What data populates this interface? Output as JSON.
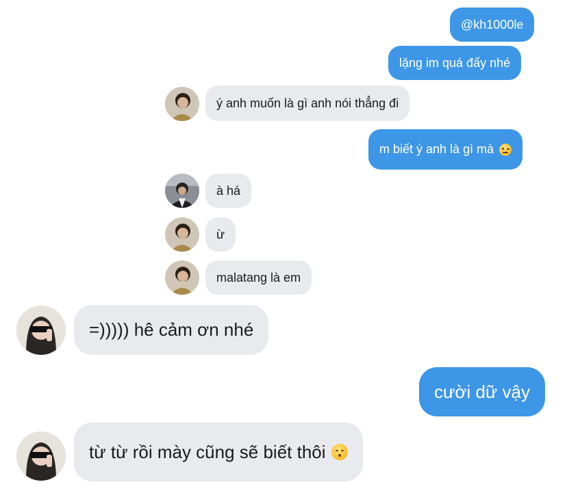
{
  "messages": [
    {
      "id": "m1",
      "side": "out",
      "text": "@kh1000le"
    },
    {
      "id": "m2",
      "side": "out",
      "text": "lặng im quá đấy nhé"
    },
    {
      "id": "m3",
      "side": "in",
      "avatar": "male-avatar",
      "text": "ý anh muốn là gì anh nói thẳng đi"
    },
    {
      "id": "m4",
      "side": "out",
      "text": "m biết ý anh là gì mà",
      "emoji": "winking-face-emoji"
    },
    {
      "id": "m5",
      "side": "in",
      "avatar": "male-avatar-2",
      "text": "à há"
    },
    {
      "id": "m6",
      "side": "in",
      "avatar": "male-avatar",
      "text": "ừ"
    },
    {
      "id": "m7",
      "side": "in",
      "avatar": "male-avatar",
      "text": "malatang là em"
    },
    {
      "id": "m8",
      "side": "in",
      "avatar": "female-avatar",
      "text": "=))))) hê cảm ơn nhé"
    },
    {
      "id": "m9",
      "side": "out",
      "text": "cười dữ vậy"
    },
    {
      "id": "m10",
      "side": "in",
      "avatar": "female-avatar",
      "text": "từ từ rồi mày cũng sẽ biết thôi",
      "emoji": "kissing-face-emoji"
    }
  ],
  "colors": {
    "outgoing_bubble": "#3d96e6",
    "incoming_bubble": "#e9eaee",
    "background": "#ffffff"
  }
}
